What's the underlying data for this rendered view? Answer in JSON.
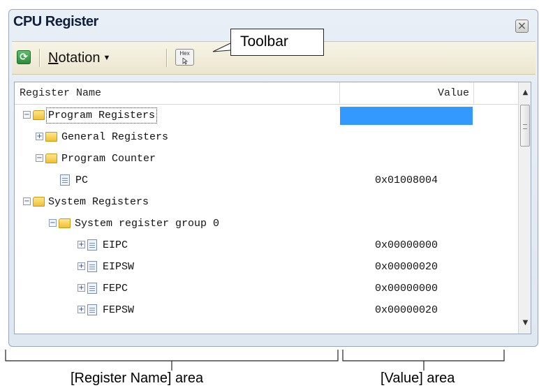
{
  "panel": {
    "title": "CPU Register",
    "close_glyph": "×"
  },
  "toolbar": {
    "refresh_icon": "refresh-icon",
    "refresh_glyph": "⟳",
    "notation_label_first": "N",
    "notation_label_rest": "otation",
    "notation_caret": "▼",
    "hex_label": "Hex"
  },
  "annotations": {
    "toolbar_callout": "Toolbar",
    "register_name_area": "[Register Name] area",
    "value_area": "[Value] area"
  },
  "grid": {
    "header_name": "Register Name",
    "header_value": "Value",
    "rows": [
      {
        "name": "Program Registers",
        "value": ""
      },
      {
        "name": "General Registers",
        "value": ""
      },
      {
        "name": "Program Counter",
        "value": ""
      },
      {
        "name": "PC",
        "value": "0x01008004"
      },
      {
        "name": "System Registers",
        "value": ""
      },
      {
        "name": "System register group 0",
        "value": ""
      },
      {
        "name": "EIPC",
        "value": "0x00000000"
      },
      {
        "name": "EIPSW",
        "value": "0x00000020"
      },
      {
        "name": "FEPC",
        "value": "0x00000000"
      },
      {
        "name": "FEPSW",
        "value": "0x00000020"
      }
    ]
  },
  "scrollbar": {
    "up_glyph": "▲",
    "down_glyph": "▼"
  },
  "colors": {
    "selection": "#3399ff",
    "folder": "#f2c030",
    "toolbar": "#ece6cf"
  }
}
